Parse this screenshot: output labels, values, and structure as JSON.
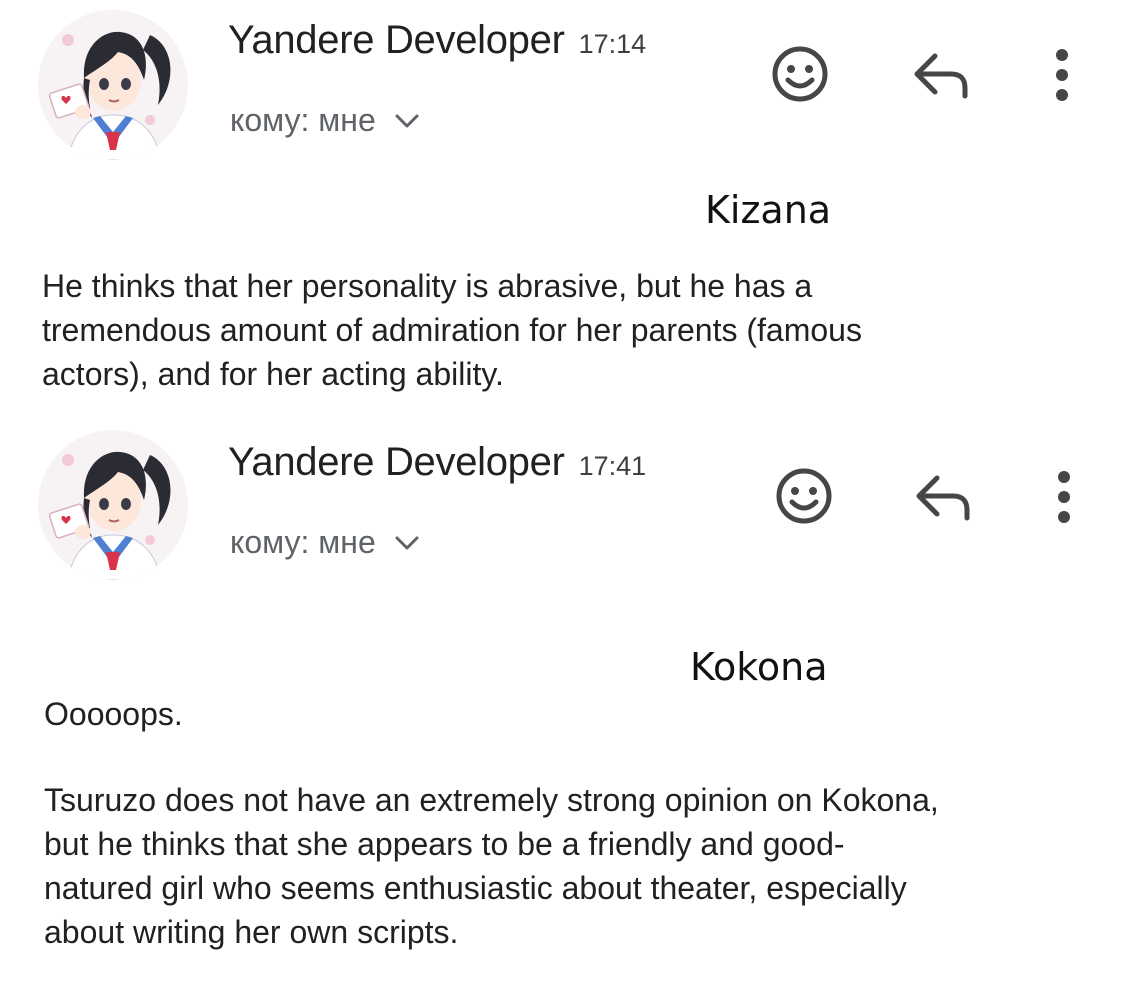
{
  "emails": [
    {
      "sender": "Yandere Developer",
      "time": "17:14",
      "recipient_label": "кому: мне",
      "overlay_label": "Kizana",
      "body": "He thinks that her personality is abrasive, but he has a\ntremendous amount of admiration for her parents (famous\nactors), and for her acting ability."
    },
    {
      "sender": "Yandere Developer",
      "time": "17:41",
      "recipient_label": "кому: мне",
      "overlay_label": "Kokona",
      "body_intro": "Ooooops.",
      "body": "Tsuruzo does not have an extremely strong opinion on Kokona,\nbut he thinks that she appears to be a friendly and good-\nnatured girl who seems enthusiastic about theater, especially\nabout writing her own scripts."
    }
  ],
  "icons": {
    "emoji": "smiley-face-icon",
    "reply": "reply-arrow-icon",
    "more": "vertical-dots-icon",
    "expand": "chevron-down-icon"
  },
  "colors": {
    "text": "#202124",
    "secondary_text": "#5f6368",
    "icon": "#444746",
    "avatar_bg": "#f7f2f4"
  }
}
